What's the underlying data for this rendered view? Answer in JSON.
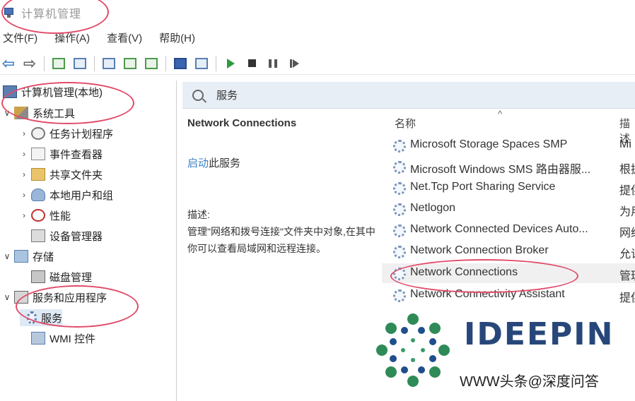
{
  "window": {
    "title": "计算机管理"
  },
  "menu": [
    "文件(F)",
    "操作(A)",
    "查看(V)",
    "帮助(H)"
  ],
  "tree": [
    {
      "id": "root",
      "label": "计算机管理(本地)",
      "icon": "computer-icon",
      "chevron": "",
      "indent": 0
    },
    {
      "id": "system-tools",
      "label": "系统工具",
      "icon": "toolbox-icon",
      "chevron": "∨",
      "indent": 1
    },
    {
      "id": "task-scheduler",
      "label": "任务计划程序",
      "icon": "clock-icon",
      "chevron": "›",
      "indent": 2
    },
    {
      "id": "event-viewer",
      "label": "事件查看器",
      "icon": "event-viewer-icon",
      "chevron": "›",
      "indent": 2
    },
    {
      "id": "shared-folders",
      "label": "共享文件夹",
      "icon": "folder-icon",
      "chevron": "›",
      "indent": 2
    },
    {
      "id": "local-users",
      "label": "本地用户和组",
      "icon": "users-icon",
      "chevron": "›",
      "indent": 2
    },
    {
      "id": "performance",
      "label": "性能",
      "icon": "performance-icon",
      "chevron": "›",
      "indent": 2
    },
    {
      "id": "device-manager",
      "label": "设备管理器",
      "icon": "device-manager-icon",
      "chevron": "",
      "indent": 2
    },
    {
      "id": "storage",
      "label": "存储",
      "icon": "storage-icon",
      "chevron": "∨",
      "indent": 1
    },
    {
      "id": "disk-management",
      "label": "磁盘管理",
      "icon": "disk-icon",
      "chevron": "",
      "indent": 2
    },
    {
      "id": "services-apps",
      "label": "服务和应用程序",
      "icon": "services-apps-icon",
      "chevron": "∨",
      "indent": 1
    },
    {
      "id": "services",
      "label": "服务",
      "icon": "gear-icon",
      "chevron": "",
      "indent": 2,
      "selected": true
    },
    {
      "id": "wmi",
      "label": "WMI 控件",
      "icon": "wmi-icon",
      "chevron": "",
      "indent": 2
    }
  ],
  "panel": {
    "header_title": "服务",
    "selected_service": "Network Connections",
    "action_link": "启动",
    "action_suffix": "此服务",
    "desc_label": "描述:",
    "desc_text": "管理\"网络和拨号连接\"文件夹中对象,在其中你可以查看局域网和远程连接。"
  },
  "list": {
    "col_name": "名称",
    "col_desc": "描述",
    "sort_indicator": "^",
    "rows": [
      {
        "name": "Microsoft Storage Spaces SMP",
        "desc": "Mi"
      },
      {
        "name": "Microsoft Windows SMS 路由器服...",
        "desc": "根据"
      },
      {
        "name": "Net.Tcp Port Sharing Service",
        "desc": "提供"
      },
      {
        "name": "Netlogon",
        "desc": "为用"
      },
      {
        "name": "Network Connected Devices Auto...",
        "desc": "网络"
      },
      {
        "name": "Network Connection Broker",
        "desc": "允许"
      },
      {
        "name": "Network Connections",
        "desc": "管理",
        "selected": true
      },
      {
        "name": "Network Connectivity Assistant",
        "desc": "提供"
      }
    ]
  },
  "watermark": {
    "brand": "IDEEPIN",
    "sub": "WWW头条@深度问答"
  },
  "colors": {
    "annotation": "#e24b6a",
    "link": "#3d7fc6",
    "brand": "#27477a"
  }
}
